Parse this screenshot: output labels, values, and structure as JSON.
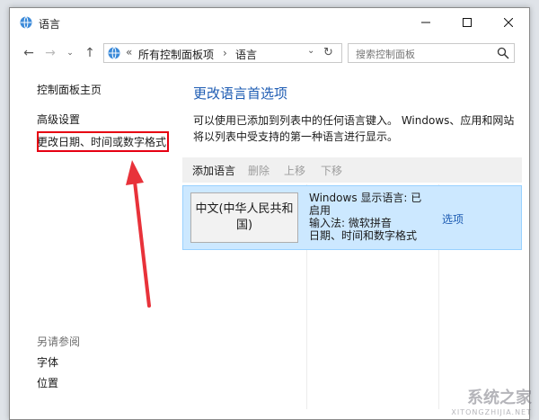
{
  "window": {
    "title": "语言"
  },
  "address": {
    "prefix": "«",
    "breadcrumb": [
      "所有控制面板项",
      "语言"
    ],
    "separator": "›",
    "search_placeholder": "搜索控制面板"
  },
  "sidebar": {
    "home": "控制面板主页",
    "advanced": "高级设置",
    "change_date": "更改日期、时间或数字格式",
    "see_also_header": "另请参阅",
    "font": "字体",
    "location": "位置"
  },
  "main": {
    "title": "更改语言首选项",
    "description": "可以使用已添加到列表中的任何语言键入。 Windows、应用和网站将以列表中受支持的第一种语言进行显示。",
    "toolbar": {
      "add": "添加语言",
      "remove": "删除",
      "up": "上移",
      "down": "下移"
    },
    "languages": [
      {
        "name": "中文(中华人民共和国)",
        "details": [
          "Windows 显示语言: 已启用",
          "输入法: 微软拼音",
          "日期、时间和数字格式"
        ],
        "options": "选项"
      }
    ]
  },
  "watermark": {
    "main": "系统之家",
    "sub": "XITONGZHIJIA.NET"
  },
  "colors": {
    "link": "#1e5cb3",
    "selection_bg": "#cce8ff",
    "highlight_box": "#e60012",
    "annotation_arrow": "#e8323a"
  }
}
